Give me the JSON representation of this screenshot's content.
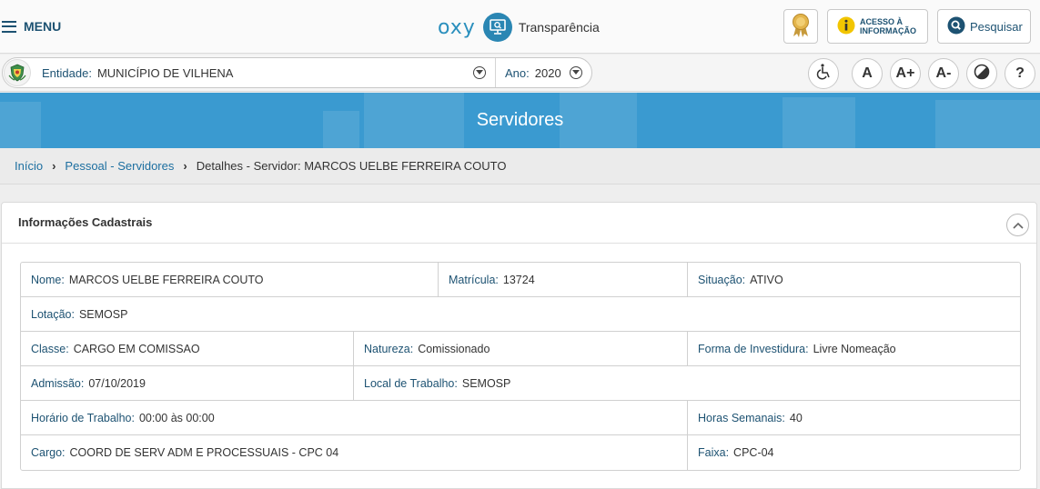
{
  "header": {
    "menu_label": "MENU",
    "brand_oxy": "oxy",
    "brand_name": "Transparência",
    "acesso_line1": "ACESSO À",
    "acesso_line2": "INFORMAÇÃO",
    "search_label": "Pesquisar"
  },
  "filters": {
    "entidade_label": "Entidade:",
    "entidade_value": "MUNICÍPIO DE VILHENA",
    "ano_label": "Ano:",
    "ano_value": "2020"
  },
  "accessibility": {
    "font_normal": "A",
    "font_increase": "A+",
    "font_decrease": "A-",
    "help": "?"
  },
  "banner": {
    "title": "Servidores"
  },
  "breadcrumb": {
    "home": "Início",
    "section": "Pessoal - Servidores",
    "current": "Detalhes - Servidor: MARCOS UELBE FERREIRA COUTO"
  },
  "panel": {
    "title": "Informações Cadastrais",
    "rows": [
      [
        {
          "label": "Nome:",
          "value": "MARCOS UELBE FERREIRA COUTO"
        },
        {
          "label": "Matrícula:",
          "value": "13724"
        },
        {
          "label": "Situação:",
          "value": "ATIVO"
        }
      ],
      [
        {
          "label": "Lotação:",
          "value": "SEMOSP"
        }
      ],
      [
        {
          "label": "Classe:",
          "value": "CARGO EM COMISSAO"
        },
        {
          "label": "Natureza:",
          "value": "Comissionado"
        },
        {
          "label": "Forma de Investidura:",
          "value": "Livre Nomeação"
        }
      ],
      [
        {
          "label": "Admissão:",
          "value": "07/10/2019"
        },
        {
          "label": "Local de Trabalho:",
          "value": "SEMOSP"
        }
      ],
      [
        {
          "label": "Horário de Trabalho:",
          "value": "00:00 às 00:00"
        },
        {
          "label": "Horas Semanais:",
          "value": "40"
        }
      ],
      [
        {
          "label": "Cargo:",
          "value": "COORD DE SERV ADM E PROCESSUAIS - CPC 04"
        },
        {
          "label": "Faixa:",
          "value": "CPC-04"
        }
      ]
    ]
  },
  "colors": {
    "primary": "#1d5272",
    "banner": "#3a9ad0",
    "link": "#1d6fa0"
  }
}
